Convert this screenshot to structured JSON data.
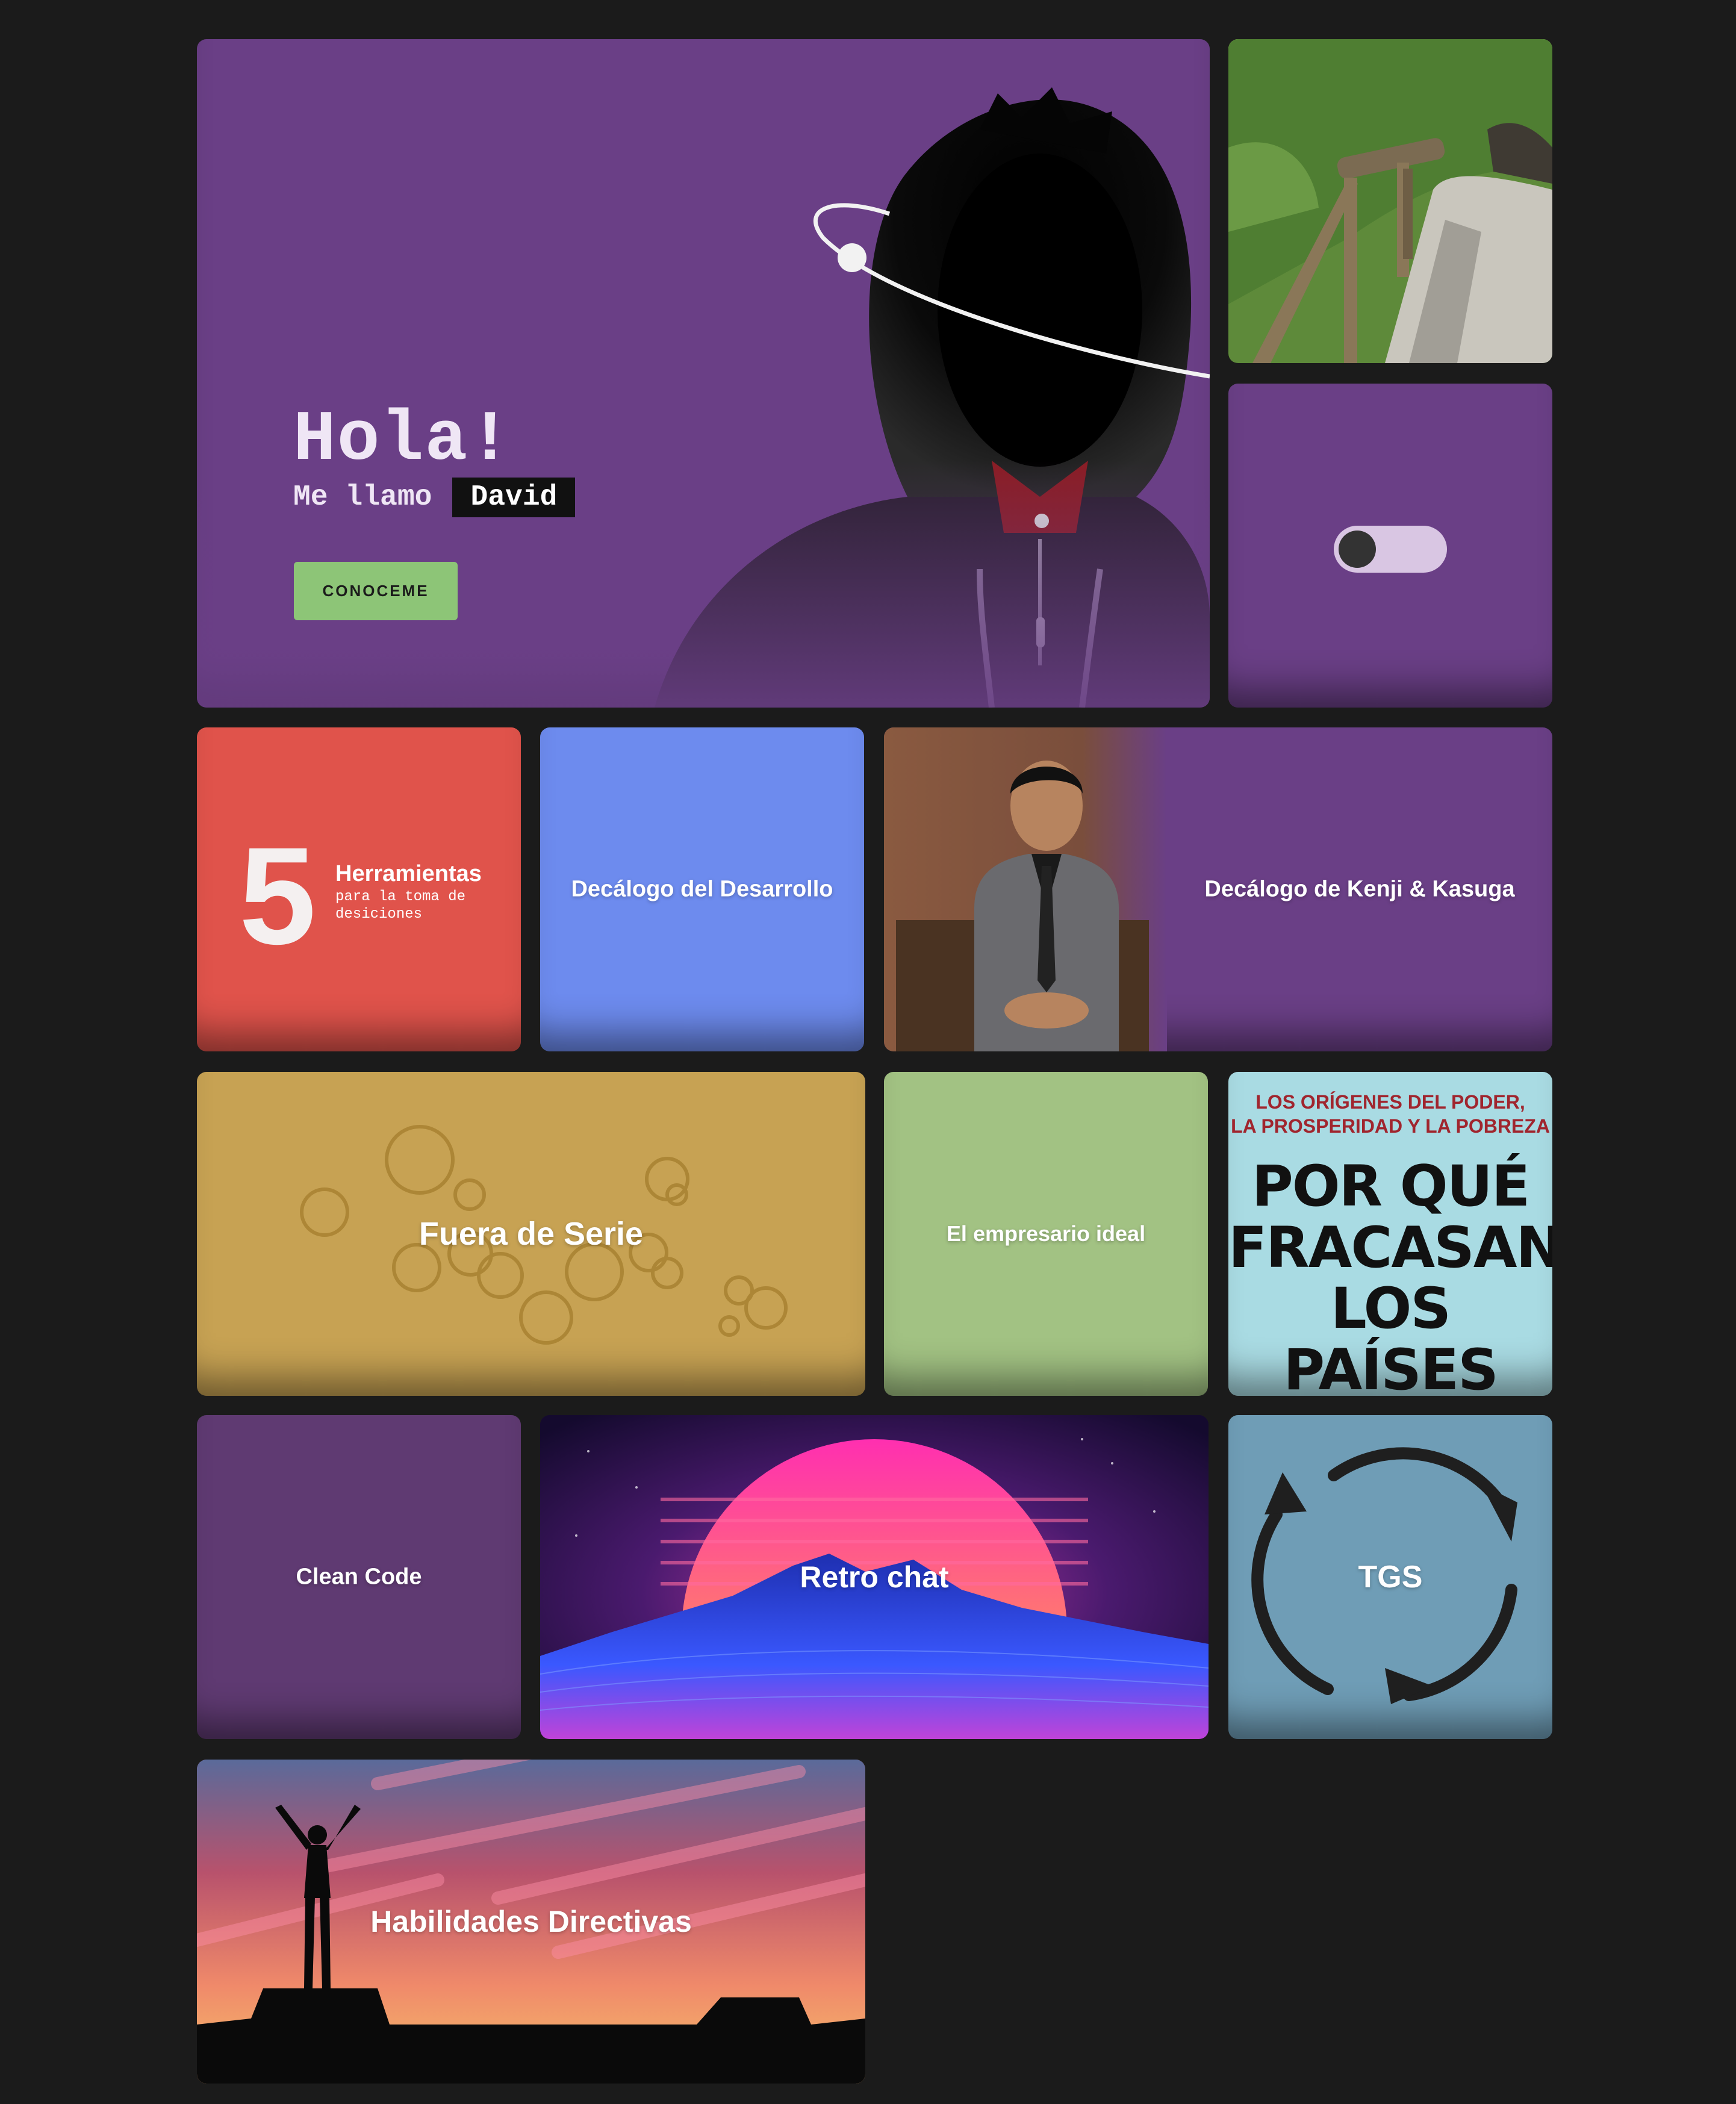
{
  "hero": {
    "greeting": "Hola!",
    "intro": "Me llamo",
    "name": "David",
    "cta_label": "CONOCEME"
  },
  "toggle": {
    "state": "off"
  },
  "tiles": {
    "tools": {
      "number": "5",
      "title": "Herramientas",
      "subtitle": "para la toma de desiciones"
    },
    "decalogo": {
      "label": "Decálogo del Desarrollo"
    },
    "kenji": {
      "label": "Decálogo de Kenji & Kasuga"
    },
    "fuera": {
      "label": "Fuera de Serie"
    },
    "empresario": {
      "label": "El empresario ideal"
    },
    "book": {
      "top_line_1": "LOS ORÍGENES DEL PODER,",
      "top_line_2": "LA PROSPERIDAD Y LA POBREZA",
      "title_1": "POR QUÉ",
      "title_2": "FRACASAN",
      "title_3": "LOS",
      "title_4": "PAÍSES"
    },
    "clean": {
      "label": "Clean Code"
    },
    "retro": {
      "label": "Retro chat"
    },
    "tgs": {
      "label": "TGS"
    },
    "habilidades": {
      "label": "Habilidades Directivas"
    }
  },
  "colors": {
    "background": "#1b1b1b",
    "purple": "#6a3f86",
    "red": "#e0534b",
    "blue": "#6d8bee",
    "mustard": "#c7a253",
    "green": "#a2c283",
    "cta_green": "#8dc577",
    "steel_blue": "#6f9db6"
  }
}
